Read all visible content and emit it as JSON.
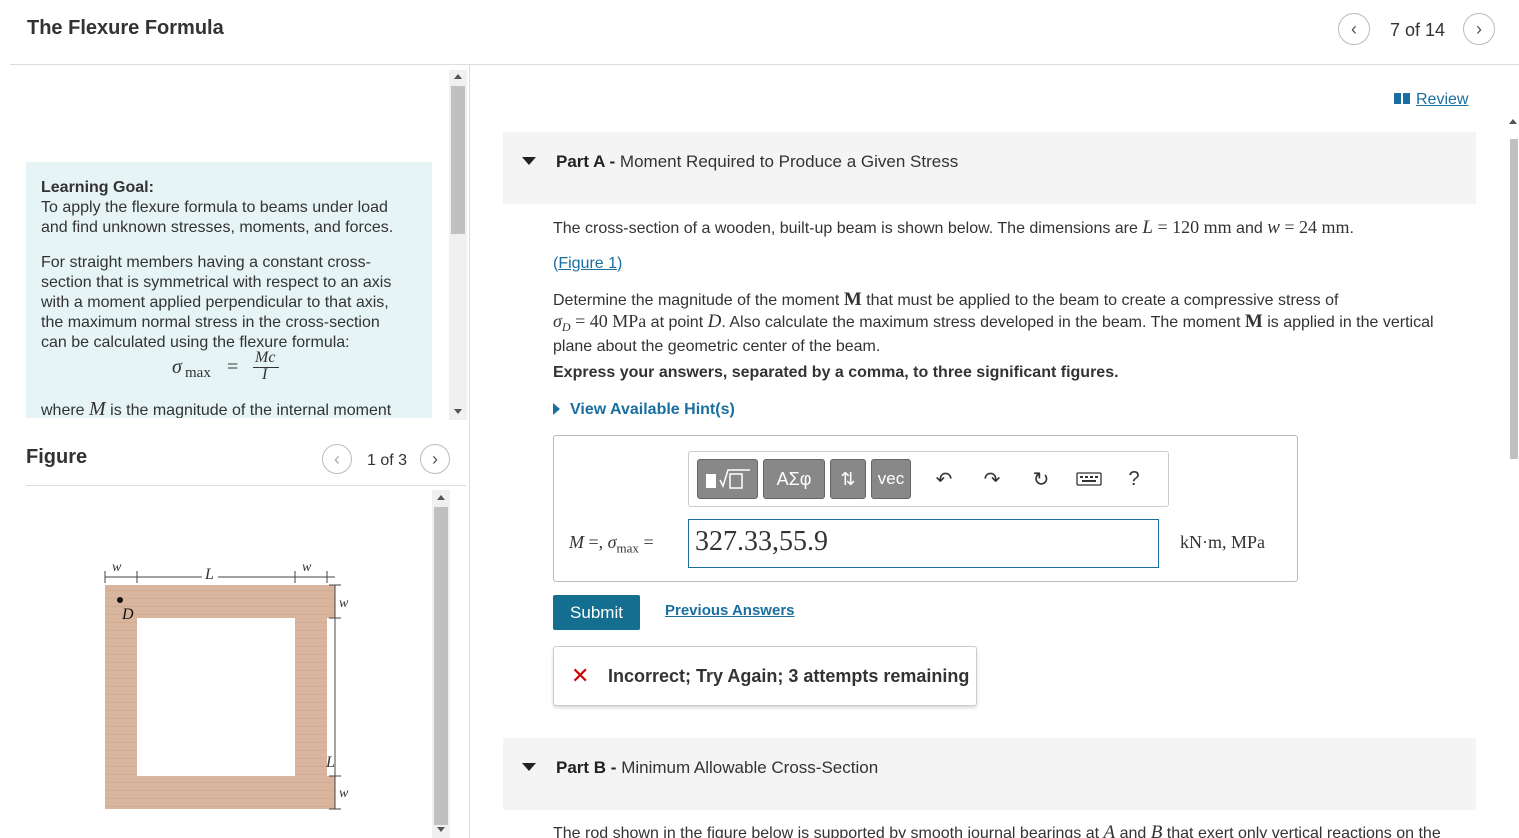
{
  "header": {
    "title": "The Flexure Formula",
    "page_counter": "7 of 14",
    "prev_icon": "chevron-left-icon",
    "next_icon": "chevron-right-icon"
  },
  "learning_goal": {
    "title": "Learning Goal:",
    "line1": "To apply the flexure formula to beams under load",
    "line2": "and find unknown stresses, moments, and forces.",
    "para2_l1": "For straight members having a constant cross-",
    "para2_l2": "section that is symmetrical with respect to an axis",
    "para2_l3": "with a moment applied perpendicular to that axis,",
    "para2_l4": "the maximum normal stress in the cross-section",
    "para2_l5": "can be calculated using the flexure formula:",
    "formula_lhs": "σ",
    "formula_sub": "max",
    "formula_eq": "=",
    "formula_num": "Mc",
    "formula_den": "I",
    "where_a": "where ",
    "where_M": "M",
    "where_b": " is the magnitude of the internal moment"
  },
  "figure": {
    "title": "Figure",
    "counter": "1 of 3",
    "labels": {
      "w_top_left": "w",
      "L_top": "L",
      "w_top_right": "w",
      "D": "D",
      "w_right_top": "w",
      "L_right": "L",
      "w_right_bottom": "w"
    },
    "wood_color": "#d9b59e"
  },
  "review": {
    "label": "Review"
  },
  "partA": {
    "prefix": "Part A - ",
    "title": "Moment Required to Produce a Given Stress",
    "q1_a": "The cross-section of a wooden, built-up beam is shown below. The dimensions are ",
    "q1_L": "L",
    "q1_b": " = 120 mm",
    "q1_c": " and ",
    "q1_w": "w",
    "q1_d": " = 24 mm",
    "q1_e": ".",
    "figure_link_open": "(",
    "figure_link": "Figure 1",
    "figure_link_close": ")",
    "q2_a": "Determine the magnitude of the moment ",
    "q2_M": "M",
    "q2_b": " that must be applied to the beam to create a compressive stress  of",
    "q2_sig": "σ",
    "q2_sub": "D",
    "q2_c": " = 40 MPa",
    "q2_d": " at point ",
    "q2_D": "D",
    "q2_e": ". Also calculate the maximum stress developed in the beam. The moment ",
    "q2_M2": "M",
    "q2_f": " is applied in the vertical",
    "q2_g": "plane about the geometric center of the beam.",
    "q3": "Express your answers, separated by a comma, to three significant figures.",
    "hints": "View Available Hint(s)",
    "toolbar": {
      "templates_icon": "templates-icon",
      "greek": "ΑΣφ",
      "arrows": "⇅",
      "vec": "vec",
      "undo_icon": "undo-icon",
      "redo_icon": "redo-icon",
      "reset_icon": "reset-icon",
      "keyboard_icon": "keyboard-icon",
      "help": "?"
    },
    "answer_label_M": "M",
    "answer_label_a": " =, ",
    "answer_label_sig": "σ",
    "answer_label_sub": "max",
    "answer_label_b": " =",
    "answer_value": "327.33,55.9",
    "answer_units": "kN·m, MPa",
    "submit": "Submit",
    "previous_answers": "Previous Answers",
    "feedback_icon": "✕",
    "feedback": "Incorrect; Try Again; 3 attempts remaining"
  },
  "partB": {
    "prefix": "Part B - ",
    "title": "Minimum Allowable Cross-Section",
    "q1_a": "The rod shown in the figure below is supported by smooth journal bearings at ",
    "q1_A": "A",
    "q1_b": " and ",
    "q1_B": "B",
    "q1_c": " that exert only vertical reactions on the"
  }
}
